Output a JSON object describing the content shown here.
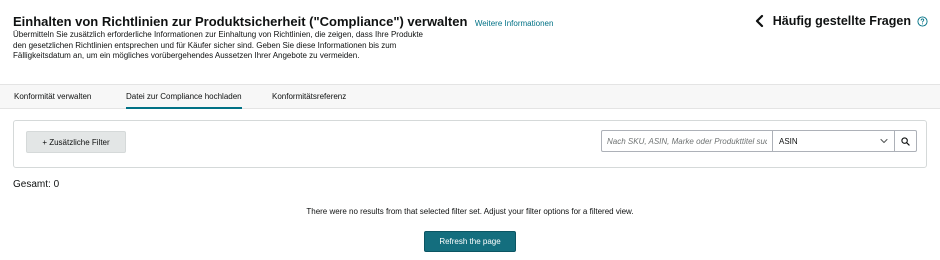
{
  "header": {
    "title": "Einhalten von Richtlinien zur Produktsicherheit (\"Compliance\") verwalten",
    "learn_more": "Weitere Informationen",
    "description_lines": [
      "Übermitteln Sie zusätzlich erforderliche Informationen zur Einhaltung von Richtlinien, die zeigen, dass Ihre Produkte",
      "den gesetzlichen Richtlinien entsprechen und für Käufer sicher sind. Geben Sie diese Informationen bis zum",
      "Fälligkeitsdatum an, um ein mögliches vorübergehendes Aussetzen Ihrer Angebote zu vermeiden."
    ],
    "faq_label": "Häufig gestellte Fragen",
    "faq_icon": "chevron-left-icon",
    "help_icon": "help-circle-icon"
  },
  "tabs": [
    {
      "label": "Konformität verwalten",
      "active": false
    },
    {
      "label": "Datei zur Compliance hochladen",
      "active": true
    },
    {
      "label": "Konformitätsreferenz",
      "active": false
    }
  ],
  "filters": {
    "add_filter_label": "+ Zusätzliche Filter",
    "search_placeholder": "Nach SKU, ASIN, Marke oder Produkttitel suchen",
    "search_value": "",
    "search_type_selected": "ASIN",
    "search_icon": "search-icon"
  },
  "results": {
    "total_label": "Gesamt: 0",
    "empty_message": "There were no results from that selected filter set. Adjust your filter options for a filtered view.",
    "refresh_label": "Refresh the page"
  },
  "colors": {
    "accent": "#007185",
    "button_primary": "#146e7e",
    "tabbar_bg": "#f7f7f7"
  }
}
